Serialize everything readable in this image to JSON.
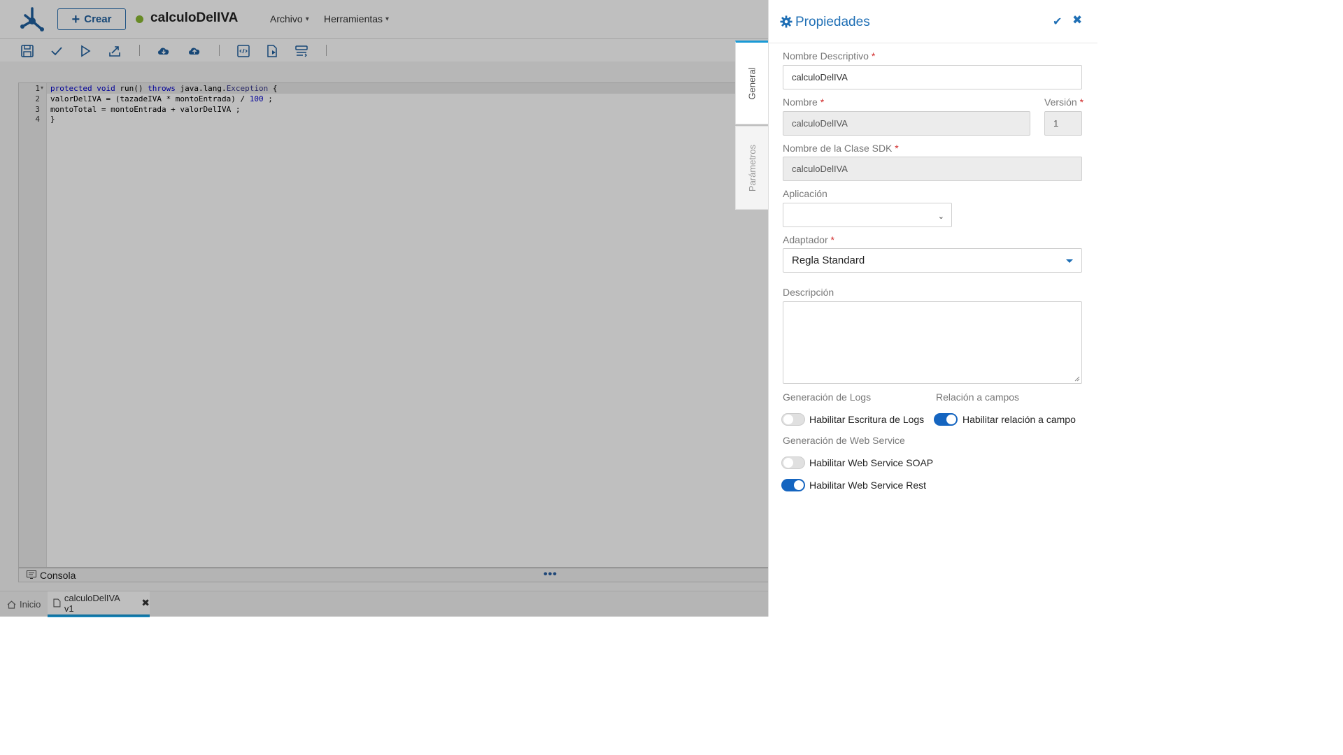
{
  "app": {
    "create_label": "Crear",
    "title": "calculoDelIVA",
    "menus": {
      "archivo": "Archivo",
      "herramientas": "Herramientas"
    }
  },
  "editor": {
    "line_numbers": [
      "1",
      "2",
      "3",
      "4"
    ]
  },
  "console": {
    "label": "Consola",
    "more": "•••"
  },
  "tabs": {
    "home": "Inicio",
    "file": "calculoDelIVA v1",
    "close": "✖"
  },
  "side_tabs": {
    "general": "General",
    "params": "Parámetros"
  },
  "panel": {
    "title": "Propiedades",
    "confirm": "✔",
    "close": "✖",
    "required_mark": "*",
    "fields": {
      "nombre_descriptivo": {
        "label": "Nombre Descriptivo",
        "value": "calculoDelIVA"
      },
      "nombre": {
        "label": "Nombre",
        "value": "calculoDelIVA"
      },
      "version": {
        "label": "Versión",
        "value": "1"
      },
      "clase_sdk": {
        "label": "Nombre de la Clase SDK",
        "value": "calculoDelIVA"
      },
      "aplicacion": {
        "label": "Aplicación",
        "value": ""
      },
      "adaptador": {
        "label": "Adaptador",
        "value": "Regla Standard"
      },
      "descripcion": {
        "label": "Descripción",
        "value": ""
      }
    },
    "sections": {
      "logs": "Generación de Logs",
      "relacion": "Relación a campos",
      "webservice": "Generación de Web Service"
    },
    "toggles": {
      "logs": {
        "label": "Habilitar Escritura de Logs",
        "on": false
      },
      "relacion": {
        "label": "Habilitar relación a campo",
        "on": true
      },
      "soap": {
        "label": "Habilitar Web Service SOAP",
        "on": false
      },
      "rest": {
        "label": "Habilitar Web Service Rest",
        "on": true
      }
    }
  },
  "colors": {
    "accent": "#1f6fb5",
    "toggle_on": "#1565c0",
    "status_dot": "#8ab832",
    "tab_highlight": "#1a9ad6"
  }
}
